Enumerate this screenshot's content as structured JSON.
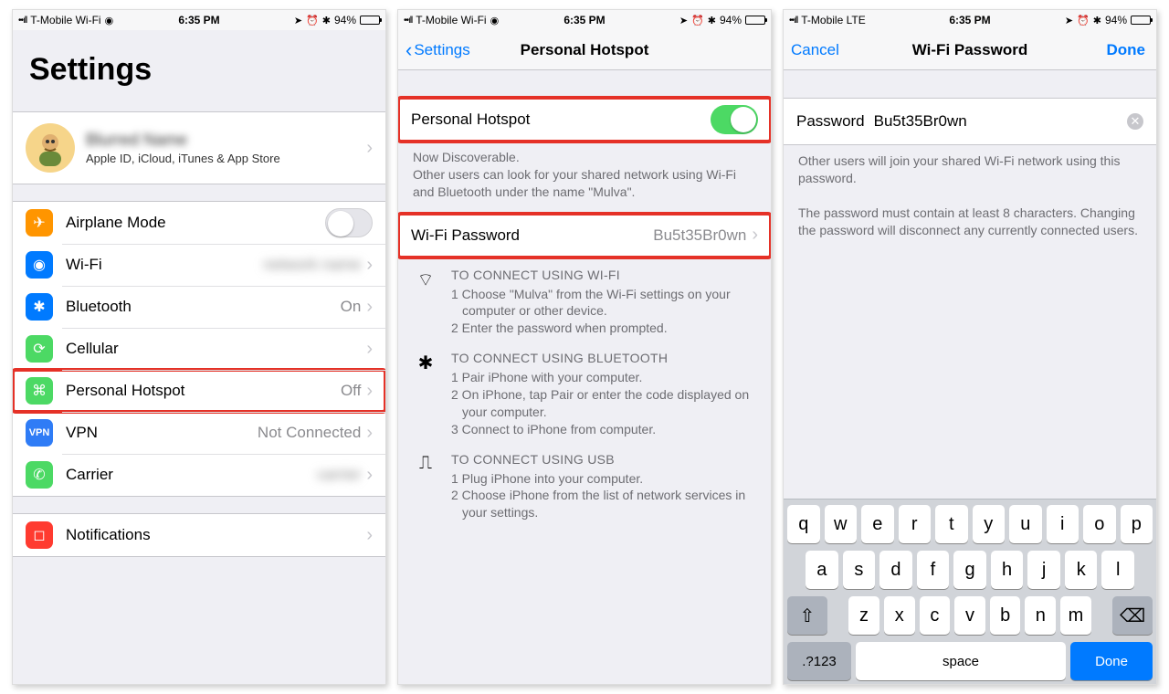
{
  "status": {
    "carrier_wifi": "T-Mobile Wi-Fi",
    "carrier_lte": "T-Mobile  LTE",
    "time": "6:35 PM",
    "battery_pct": "94%"
  },
  "screen1": {
    "title": "Settings",
    "profile": {
      "name": "Blurred Name",
      "sub": "Apple ID, iCloud, iTunes & App Store"
    },
    "rows": {
      "airplane": {
        "label": "Airplane Mode"
      },
      "wifi": {
        "label": "Wi-Fi",
        "value": "network name"
      },
      "bluetooth": {
        "label": "Bluetooth",
        "value": "On"
      },
      "cellular": {
        "label": "Cellular"
      },
      "hotspot": {
        "label": "Personal Hotspot",
        "value": "Off"
      },
      "vpn": {
        "label": "VPN",
        "value": "Not Connected",
        "badge": "VPN"
      },
      "carrier": {
        "label": "Carrier",
        "value": "carrier"
      },
      "notifications": {
        "label": "Notifications"
      }
    }
  },
  "screen2": {
    "back": "Settings",
    "title": "Personal Hotspot",
    "toggle_label": "Personal Hotspot",
    "discoverable_title": "Now Discoverable.",
    "discoverable_body": "Other users can look for your shared network using Wi-Fi and Bluetooth under the name \"Mulva\".",
    "wifi_pw_label": "Wi-Fi Password",
    "wifi_pw_value": "Bu5t35Br0wn",
    "wifi_instr_title": "TO CONNECT USING WI-FI",
    "wifi_instr_1": "1 Choose \"Mulva\" from the Wi-Fi settings on your computer or other device.",
    "wifi_instr_2": "2 Enter the password when prompted.",
    "bt_instr_title": "TO CONNECT USING BLUETOOTH",
    "bt_instr_1": "1 Pair iPhone with your computer.",
    "bt_instr_2": "2 On iPhone, tap Pair or enter the code displayed on your computer.",
    "bt_instr_3": "3 Connect to iPhone from computer.",
    "usb_instr_title": "TO CONNECT USING USB",
    "usb_instr_1": "1 Plug iPhone into your computer.",
    "usb_instr_2": "2 Choose iPhone from the list of network services in your settings."
  },
  "screen3": {
    "cancel": "Cancel",
    "title": "Wi-Fi Password",
    "done": "Done",
    "pw_label": "Password",
    "pw_value": "Bu5t35Br0wn",
    "help1": "Other users will join your shared Wi-Fi network using this password.",
    "help2": "The password must contain at least 8 characters. Changing the password will disconnect any currently connected users.",
    "keys_r1": [
      "q",
      "w",
      "e",
      "r",
      "t",
      "y",
      "u",
      "i",
      "o",
      "p"
    ],
    "keys_r2": [
      "a",
      "s",
      "d",
      "f",
      "g",
      "h",
      "j",
      "k",
      "l"
    ],
    "keys_r3": [
      "z",
      "x",
      "c",
      "v",
      "b",
      "n",
      "m"
    ],
    "key_numbers": ".?123",
    "key_space": "space",
    "key_done": "Done"
  }
}
